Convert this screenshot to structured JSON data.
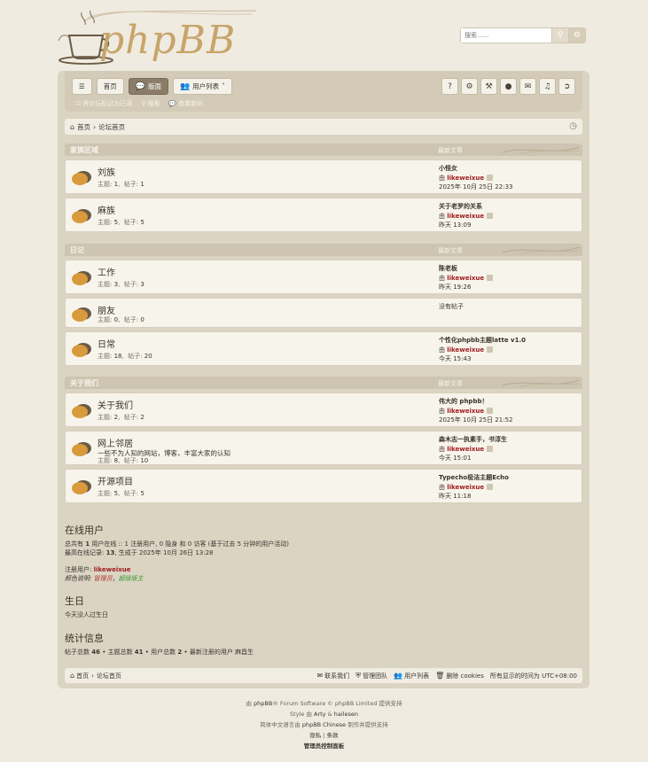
{
  "header": {
    "logo_text": "phpBB",
    "search_placeholder": "搜索......"
  },
  "nav": {
    "menu_icon": "hamburger-icon",
    "home": "首页",
    "forums": "版面",
    "memberlist": "用户列表",
    "mark_read": "将论坛标记为已读",
    "search": "搜索",
    "new_posts": "查看新帖"
  },
  "breadcrumb": {
    "home": "首页",
    "forum_index": "论坛首页"
  },
  "categories": [
    {
      "title": "家族区域",
      "last_post_label": "最新文章",
      "forums": [
        {
          "name": "刘族",
          "desc": "",
          "topics_label": "主题:",
          "topics": "1",
          "posts_label": "帖子:",
          "posts": "1",
          "last_title": "小怪女",
          "by": "由",
          "user": "likeweixue",
          "time": "2025年 10月 25日 22:33"
        },
        {
          "name": "麻族",
          "desc": "",
          "topics_label": "主题:",
          "topics": "5",
          "posts_label": "帖子:",
          "posts": "5",
          "last_title": "关于老罗的关系",
          "by": "由",
          "user": "likeweixue",
          "time": "昨天 13:09"
        }
      ]
    },
    {
      "title": "日记",
      "last_post_label": "最新文章",
      "forums": [
        {
          "name": "工作",
          "desc": "",
          "topics_label": "主题:",
          "topics": "3",
          "posts_label": "帖子:",
          "posts": "3",
          "last_title": "陈老板",
          "by": "由",
          "user": "likeweixue",
          "time": "昨天 19:26"
        },
        {
          "name": "朋友",
          "desc": "",
          "topics_label": "主题:",
          "topics": "0",
          "posts_label": "帖子:",
          "posts": "0",
          "last_title": "没有帖子",
          "by": "",
          "user": "",
          "time": ""
        },
        {
          "name": "日常",
          "desc": "",
          "topics_label": "主题:",
          "topics": "18",
          "posts_label": "帖子:",
          "posts": "20",
          "last_title": "个性化phpbb主题latte v1.0",
          "by": "由",
          "user": "likeweixue",
          "time": "今天 15:43"
        }
      ]
    },
    {
      "title": "关于我们",
      "last_post_label": "最新文章",
      "forums": [
        {
          "name": "关于我们",
          "desc": "",
          "topics_label": "主题:",
          "topics": "2",
          "posts_label": "帖子:",
          "posts": "2",
          "last_title": "伟大的 phpbb！",
          "by": "由",
          "user": "likeweixue",
          "time": "2025年 10月 25日 21:52"
        },
        {
          "name": "网上邻居",
          "desc": "一些不为人知的网站，博客，丰富大家的认知",
          "topics_label": "主题:",
          "topics": "8",
          "posts_label": "帖子:",
          "posts": "10",
          "last_title": "森木志一执素手，书淳生",
          "by": "由",
          "user": "likeweixue",
          "time": "今天 15:01"
        },
        {
          "name": "开源项目",
          "desc": "",
          "topics_label": "主题:",
          "topics": "5",
          "posts_label": "帖子:",
          "posts": "5",
          "last_title": "Typecho极洁主题Echo",
          "by": "由",
          "user": "likeweixue",
          "time": "昨天 11:18"
        }
      ]
    }
  ],
  "online": {
    "title": "在线用户",
    "line1_a": "总共有 ",
    "line1_b": "1",
    "line1_c": " 用户在线 :: 1 注册用户, 0 隐身 和 0 访客 (基于过去 5 分钟的用户活动)",
    "line2_a": "最高在线记录: ",
    "line2_b": "13",
    "line2_c": ", 生成于 2025年 10月 26日 13:28",
    "registered_label": "注册用户:",
    "registered_user": "likeweixue",
    "legend_label": "颜色说明:",
    "legend_admin": "管理员",
    "legend_sep": "，",
    "legend_smod": "超级版主"
  },
  "birthdays": {
    "title": "生日",
    "text": "今天没人过生日"
  },
  "stats": {
    "title": "统计信息",
    "posts_label": "帖子总数 ",
    "posts": "46",
    "topics_label": " • 主题总数 ",
    "topics": "41",
    "users_label": " • 用户总数 ",
    "users": "2",
    "newest_label": " • 最新注册的用户 ",
    "newest": "麻昌生"
  },
  "footer": {
    "home": "首页",
    "forum_index": "论坛首页",
    "contact": "联系我们",
    "team": "管理团队",
    "members": "用户列表",
    "delete_cookies": "删除 cookies",
    "timezone": "所有显示的时间为 UTC+08:00"
  },
  "copyright": {
    "line1_a": "由 ",
    "line1_link": "phpBB",
    "line1_b": "® Forum Software © phpBB Limited 提供支持",
    "line2_a": "Style 由 ",
    "line2_l1": "Arty",
    "line2_amp": " & ",
    "line2_l2": "hailesen",
    "line3_a": "简体中文语言由 ",
    "line3_link": "phpBB Chinese",
    "line3_b": " 制作并提供支持",
    "privacy": "隐私",
    "sep": " | ",
    "terms": "条款",
    "acp": "管理员控制面板"
  }
}
